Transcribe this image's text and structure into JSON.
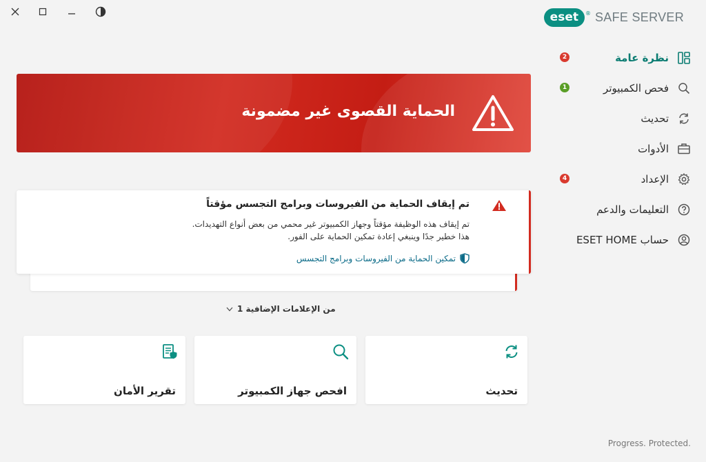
{
  "window": {
    "controls": {
      "close_icon": "close-icon",
      "maximize_icon": "maximize-icon",
      "minimize_icon": "minimize-icon",
      "theme_icon": "contrast-icon"
    }
  },
  "brand": {
    "logo_text": "eset",
    "product": "SAFE SERVER",
    "accent": "#0b8f82"
  },
  "sidebar": {
    "items": [
      {
        "label": "نظرة عامة",
        "icon": "dashboard-icon",
        "badge": "2",
        "badge_color": "#d93a2e",
        "active": true
      },
      {
        "label": "فحص الكمبيوتر",
        "icon": "search-icon",
        "badge": "1",
        "badge_color": "#5a9e26"
      },
      {
        "label": "تحديث",
        "icon": "refresh-icon"
      },
      {
        "label": "الأدوات",
        "icon": "toolbox-icon"
      },
      {
        "label": "الإعداد",
        "icon": "gear-icon",
        "badge": "4",
        "badge_color": "#d93a2e"
      },
      {
        "label": "التعليمات والدعم",
        "icon": "help-icon"
      },
      {
        "label": "ESET HOME حساب",
        "icon": "account-icon"
      }
    ]
  },
  "hero": {
    "title": "الحماية القصوى غير مضمونة",
    "icon": "warning-icon",
    "color": "#c41d14"
  },
  "notification": {
    "title": "تم إيقاف الحماية من الفيروسات وبرامج التجسس مؤقتاً",
    "body_line1": "تم إيقاف هذه الوظيفة مؤقتاً وجهاز الكمبيوتر غير محمي من بعض أنواع التهديدات.",
    "body_line2": "هذا خطير جدًا وينبغي إعادة تمكين الحماية على الفور.",
    "link": "تمكين الحماية من الفيروسات وبرامج التجسس",
    "icon": "alert-icon",
    "link_icon": "shield-icon"
  },
  "more_notifications": {
    "label": "1 من الإعلامات الإضافية"
  },
  "cards": [
    {
      "label": "تحديث",
      "icon": "refresh-icon"
    },
    {
      "label": "افحص جهاز الكمبيوتر",
      "icon": "search-icon"
    },
    {
      "label": "تقرير الأمان",
      "icon": "security-report-icon"
    }
  ],
  "footer": {
    "text": "Progress. Protected."
  }
}
